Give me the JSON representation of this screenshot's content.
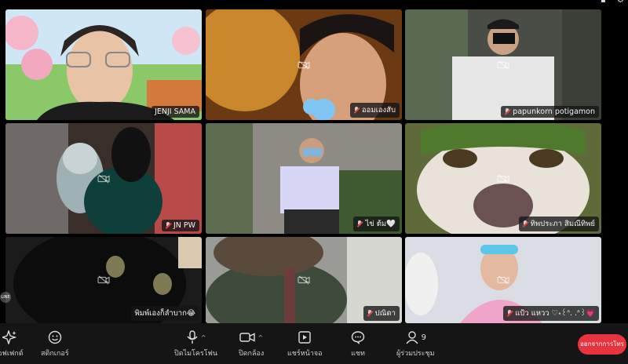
{
  "participants": [
    {
      "name": "JENJI SAMA",
      "mic_muted": false,
      "camera_on": true
    },
    {
      "name": "ออมเองสับ",
      "mic_muted": true,
      "camera_on": false
    },
    {
      "name": "papunkorn potigamon",
      "mic_muted": true,
      "camera_on": false
    },
    {
      "name": "JN PW",
      "mic_muted": true,
      "camera_on": false
    },
    {
      "name": "ไข่ ต้ม🤍",
      "mic_muted": true,
      "camera_on": true
    },
    {
      "name": "ทิพประภา สิมณีทิพย์",
      "mic_muted": true,
      "camera_on": false
    },
    {
      "name": "พิมพ์เองก็ลำบาก😂",
      "mic_muted": false,
      "camera_on": false
    },
    {
      "name": "ปณิดา",
      "mic_muted": true,
      "camera_on": false
    },
    {
      "name": "แป้ว แหวว ♡˖꒰ᐢ. .ᐢ꒱💗",
      "mic_muted": true,
      "camera_on": false
    }
  ],
  "side_badge": "LINE",
  "controls": {
    "effects_label": "เอฟเฟกต์",
    "stickers_label": "สติกเกอร์",
    "mic_label": "ปิดไมโครโฟน",
    "camera_label": "ปิดกล้อง",
    "share_label": "แชร์หน้าจอ",
    "chat_label": "แชท",
    "participants_label": "ผู้ร่วมประชุม",
    "participants_count": "9",
    "leave_label": "ออกจากการโทร"
  },
  "colors": {
    "leave_button": "#e8343f",
    "background": "#000000",
    "control_bar": "#151515"
  }
}
